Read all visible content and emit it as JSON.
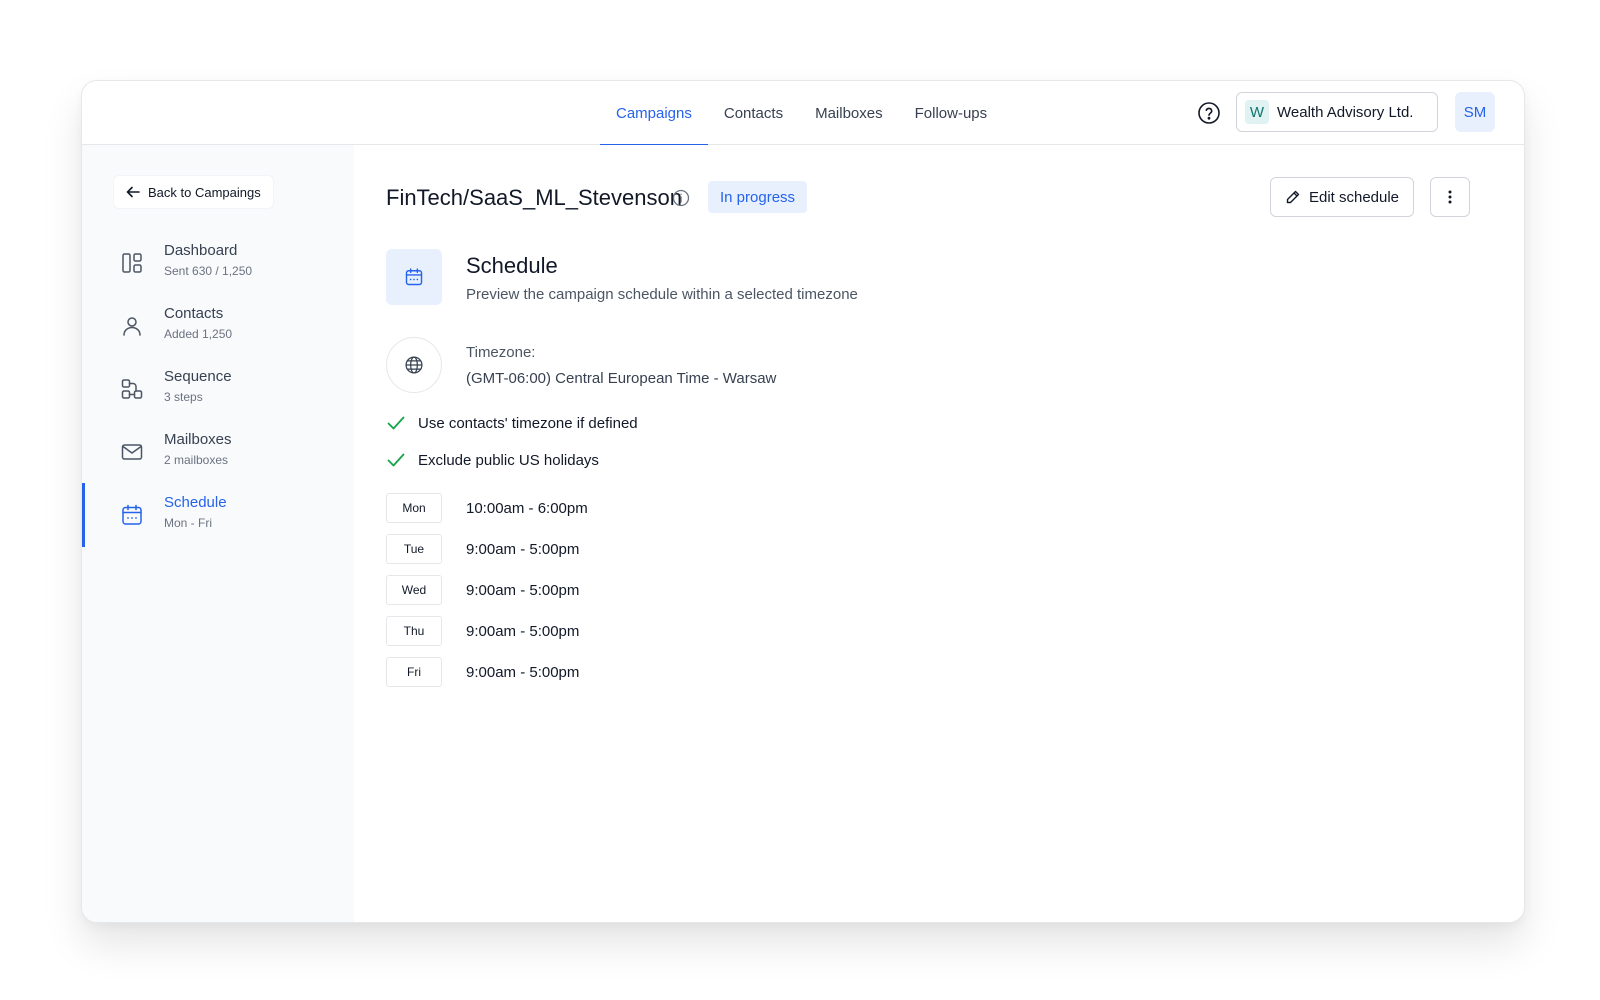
{
  "nav": {
    "tabs": [
      {
        "label": "Campaigns",
        "active": true
      },
      {
        "label": "Contacts"
      },
      {
        "label": "Mailboxes"
      },
      {
        "label": "Follow-ups"
      }
    ],
    "help_icon": "question-circle-icon",
    "org": {
      "initial": "W",
      "name": "Wealth Advisory Ltd."
    },
    "user_initials": "SM"
  },
  "sidebar": {
    "back_label": "Back to Campaings",
    "items": [
      {
        "title": "Dashboard",
        "subtitle": "Sent 630 / 1,250",
        "icon": "dashboard-icon"
      },
      {
        "title": "Contacts",
        "subtitle": "Added 1,250",
        "icon": "user-icon"
      },
      {
        "title": "Sequence",
        "subtitle": "3 steps",
        "icon": "sequence-icon"
      },
      {
        "title": "Mailboxes",
        "subtitle": "2 mailboxes",
        "icon": "mail-icon"
      },
      {
        "title": "Schedule",
        "subtitle": "Mon - Fri",
        "icon": "calendar-icon",
        "active": true
      }
    ]
  },
  "campaign": {
    "title": "FinTech/SaaS_ML_Stevenson",
    "status": "In progress",
    "edit_label": "Edit schedule"
  },
  "schedule": {
    "heading": "Schedule",
    "description": "Preview the campaign schedule within a selected timezone",
    "timezone_label": "Timezone:",
    "timezone_value": "(GMT-06:00) Central European Time - Warsaw",
    "options": [
      "Use contacts' timezone if defined",
      "Exclude public US holidays"
    ],
    "days": [
      {
        "day": "Mon",
        "hours": "10:00am - 6:00pm"
      },
      {
        "day": "Tue",
        "hours": "9:00am - 5:00pm"
      },
      {
        "day": "Wed",
        "hours": "9:00am - 5:00pm"
      },
      {
        "day": "Thu",
        "hours": "9:00am - 5:00pm"
      },
      {
        "day": "Fri",
        "hours": "9:00am - 5:00pm"
      }
    ]
  },
  "colors": {
    "accent": "#2563eb",
    "accent_bg": "#e8f0fe",
    "check": "#16a34a",
    "sidebar_bg": "#f8fafc"
  }
}
